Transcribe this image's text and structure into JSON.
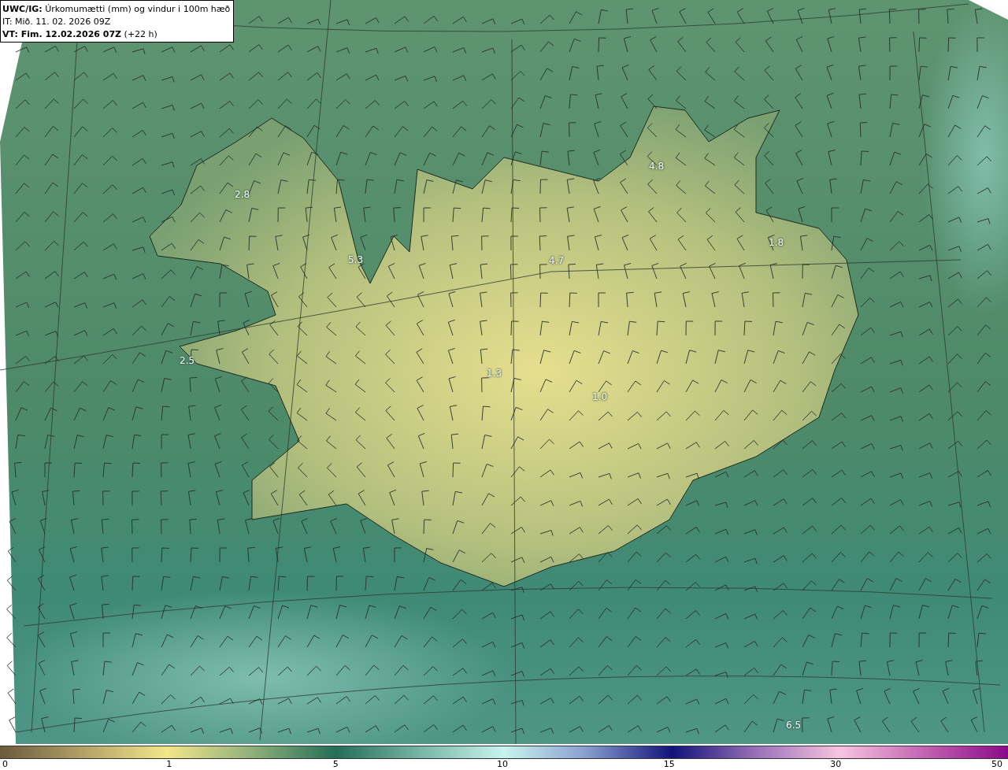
{
  "header": {
    "title": "**UWC/IG:** Úrkomumætti (mm) og vindur i 100m hæð",
    "issue_time": "IT: Mið. 11. 02. 2026 09Z",
    "valid_time": "**VT: Fim. 12.02.2026 07Z** (+22 h)"
  },
  "map_labels": [
    {
      "text": "2.8"
    },
    {
      "text": "5.3"
    },
    {
      "text": "4.7"
    },
    {
      "text": "4.8"
    },
    {
      "text": "1.8"
    },
    {
      "text": "2.5"
    },
    {
      "text": "1.3"
    },
    {
      "text": "1.0"
    },
    {
      "text": "6.5"
    }
  ],
  "colorbar": {
    "ticks": [
      "0",
      "1",
      "5",
      "10",
      "15",
      "30",
      "50"
    ]
  }
}
